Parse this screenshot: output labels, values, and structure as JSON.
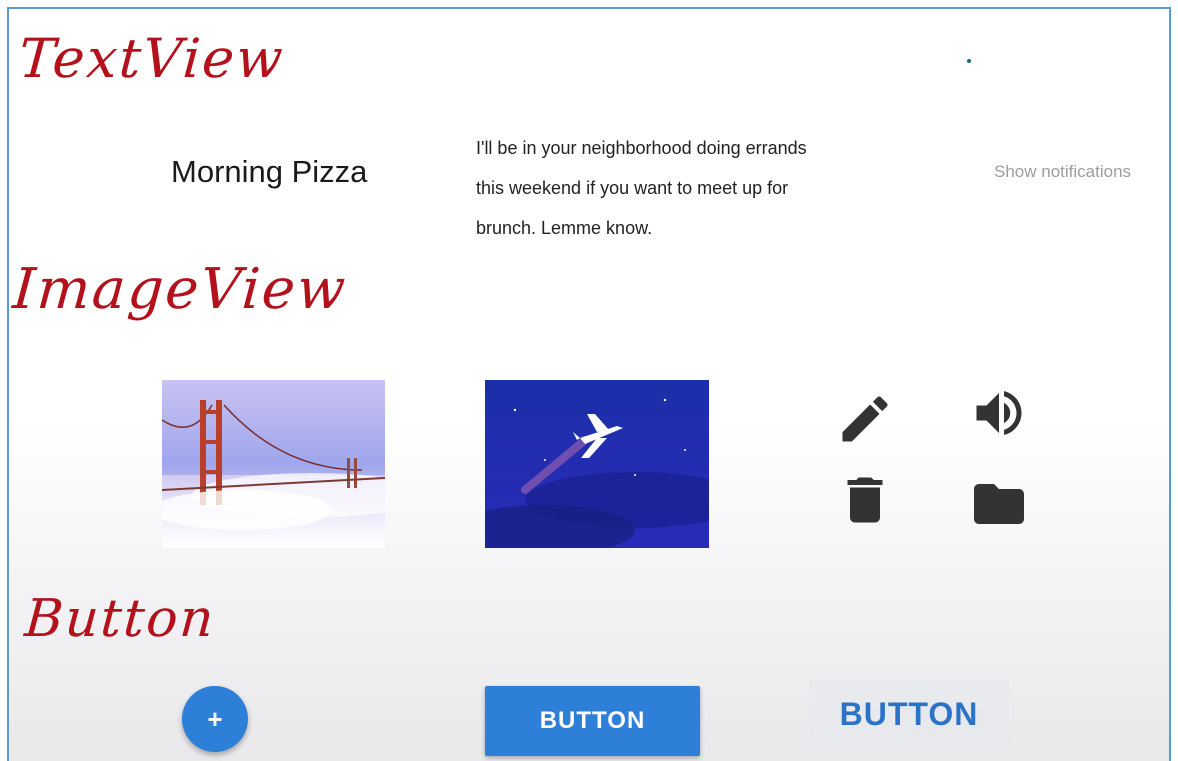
{
  "annotations": {
    "textview": "TextView",
    "imageview": "ImageView",
    "button": "Button"
  },
  "textview": {
    "title": "Morning Pizza",
    "body_lines": [
      "I'll be in your neighborhood doing errands",
      "this weekend if you want to meet up for",
      "brunch. Lemme know."
    ],
    "hint": "Show notifications"
  },
  "imageview": {
    "images": [
      "golden-gate-bridge-photo",
      "airplane-illustration"
    ],
    "icons": [
      "pencil-icon",
      "volume-icon",
      "trash-icon",
      "folder-icon"
    ]
  },
  "buttons": {
    "fab_label": "+",
    "contained_label": "BUTTON",
    "text_label": "BUTTON"
  },
  "colors": {
    "annotation_red": "#b3121c",
    "button_blue": "#2d7fd8",
    "text_button_blue": "#2a73c7",
    "icon_dark": "#333333"
  }
}
